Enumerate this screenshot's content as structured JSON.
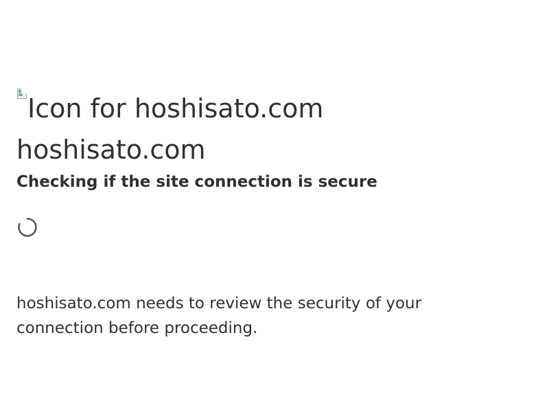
{
  "site": {
    "icon_alt": "Icon for hoshisato.com",
    "domain": "hoshisato.com"
  },
  "status": {
    "checking": "Checking if the site connection is secure",
    "spinner_icon": "loading-spinner-icon"
  },
  "message": {
    "review": "hoshisato.com needs to review the security of your connection before proceeding."
  },
  "colors": {
    "text": "#313131",
    "background": "#ffffff",
    "spinner": "#595959"
  }
}
